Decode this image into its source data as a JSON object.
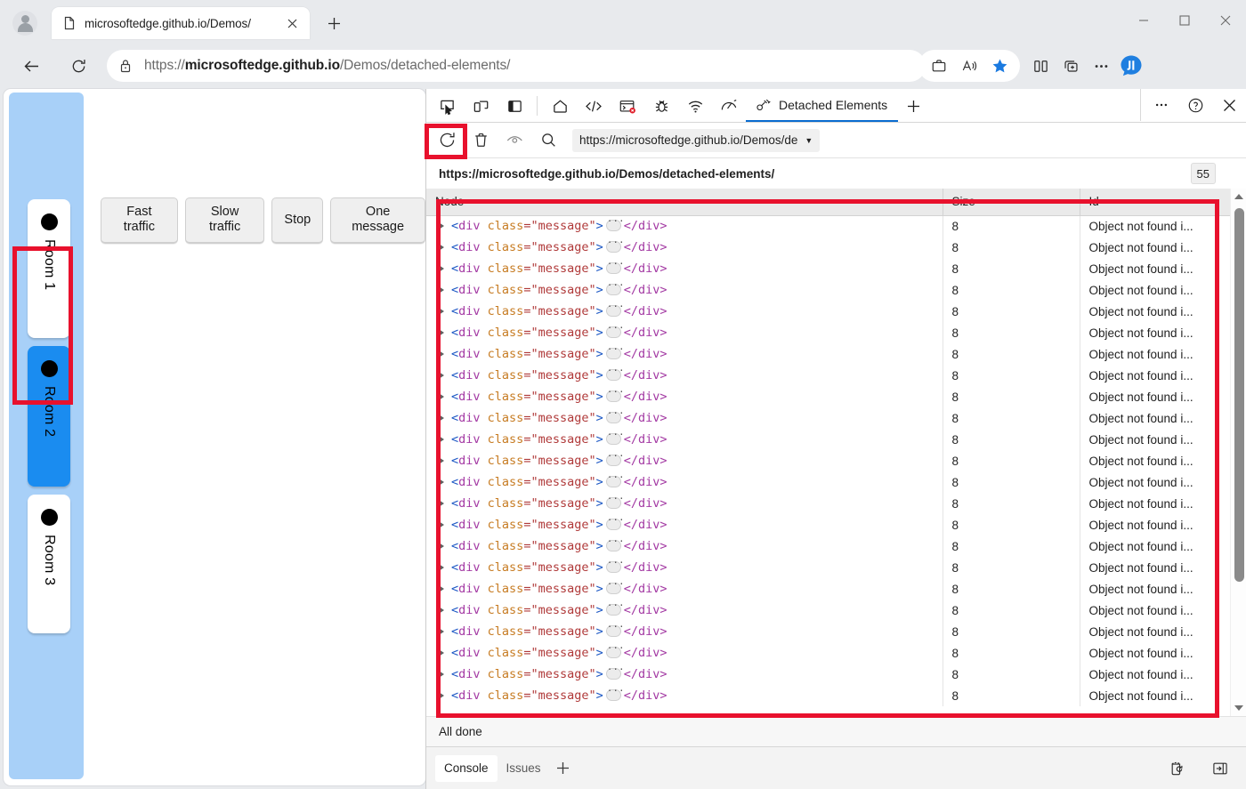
{
  "browser": {
    "tab": {
      "title": "microsoftedge.github.io/Demos/",
      "favicon_icon": "page-icon",
      "close_icon": "close-icon"
    },
    "new_tab_icon": "plus-icon",
    "window_controls": {
      "minimize_icon": "minimize-icon",
      "maximize_icon": "maximize-icon",
      "close_icon": "close-icon"
    },
    "nav": {
      "back_icon": "back-arrow-icon",
      "reload_icon": "reload-icon"
    },
    "omnibox": {
      "lock_icon": "lock-icon",
      "url_scheme": "https://",
      "url_host": "microsoftedge.github.io",
      "url_path": "/Demos/detached-elements/",
      "url_full": "https://microsoftedge.github.io/Demos/detached-elements/"
    },
    "toolbar_right": {
      "collections_icon": "briefcase-icon",
      "read_aloud_icon": "read-aloud-icon",
      "favorite_icon": "star-filled-icon",
      "split_screen_icon": "split-screen-icon",
      "add_tab_group_icon": "add-tab-group-icon",
      "settings_more_icon": "ellipsis-icon",
      "copilot_icon": "copilot-icon"
    }
  },
  "page": {
    "buttons": [
      {
        "label": "Fast traffic"
      },
      {
        "label": "Slow traffic"
      },
      {
        "label": "Stop"
      },
      {
        "label": "One message"
      }
    ],
    "rooms": [
      {
        "label": "Room 1",
        "selected": false
      },
      {
        "label": "Room 2",
        "selected": true
      },
      {
        "label": "Room 3",
        "selected": false
      }
    ]
  },
  "devtools": {
    "tools": [
      {
        "name": "inspect-element",
        "icon": "inspect-cursor-icon"
      },
      {
        "name": "device-emulation",
        "icon": "device-toggle-icon"
      },
      {
        "name": "panel-layout",
        "icon": "panel-layout-icon"
      }
    ],
    "panels": [
      {
        "name": "welcome",
        "icon": "home-icon"
      },
      {
        "name": "elements",
        "icon": "code-brackets-icon"
      },
      {
        "name": "console",
        "icon": "console-error-icon"
      },
      {
        "name": "sources",
        "icon": "bug-icon"
      },
      {
        "name": "network",
        "icon": "wifi-icon"
      },
      {
        "name": "performance",
        "icon": "gauge-icon"
      }
    ],
    "selected_panel": {
      "label": "Detached Elements",
      "icon": "detached-elements-icon"
    },
    "add_panel_icon": "plus-icon",
    "tabbar_right": {
      "more_icon": "ellipsis-icon",
      "help_icon": "help-circle-icon",
      "close_icon": "close-icon"
    },
    "toolbar": {
      "refresh_icon": "refresh-icon",
      "delete_icon": "trash-icon",
      "detach_icon": "eye-detach-icon",
      "search_icon": "search-icon",
      "target_select_value": "https://microsoftedge.github.io/Demos/de",
      "target_select_caret": "chevron-down-icon"
    },
    "detached_panel": {
      "origin": "https://microsoftedge.github.io/Demos/detached-elements/",
      "count_badge": "55",
      "columns": [
        "Node",
        "Size",
        "Id"
      ],
      "row_node": {
        "expander_icon": "expand-triangle-icon",
        "open_bracket": "<",
        "tag": "div",
        "attr_name": "class",
        "attr_eq_value": "=\"message\"",
        "close_bracket": ">",
        "children_chip": "···",
        "close_tag": "</div>"
      },
      "rows": [
        {
          "size": "8",
          "id": "Object not found i..."
        },
        {
          "size": "8",
          "id": "Object not found i..."
        },
        {
          "size": "8",
          "id": "Object not found i..."
        },
        {
          "size": "8",
          "id": "Object not found i..."
        },
        {
          "size": "8",
          "id": "Object not found i..."
        },
        {
          "size": "8",
          "id": "Object not found i..."
        },
        {
          "size": "8",
          "id": "Object not found i..."
        },
        {
          "size": "8",
          "id": "Object not found i..."
        },
        {
          "size": "8",
          "id": "Object not found i..."
        },
        {
          "size": "8",
          "id": "Object not found i..."
        },
        {
          "size": "8",
          "id": "Object not found i..."
        },
        {
          "size": "8",
          "id": "Object not found i..."
        },
        {
          "size": "8",
          "id": "Object not found i..."
        },
        {
          "size": "8",
          "id": "Object not found i..."
        },
        {
          "size": "8",
          "id": "Object not found i..."
        },
        {
          "size": "8",
          "id": "Object not found i..."
        },
        {
          "size": "8",
          "id": "Object not found i..."
        },
        {
          "size": "8",
          "id": "Object not found i..."
        },
        {
          "size": "8",
          "id": "Object not found i..."
        },
        {
          "size": "8",
          "id": "Object not found i..."
        },
        {
          "size": "8",
          "id": "Object not found i..."
        },
        {
          "size": "8",
          "id": "Object not found i..."
        },
        {
          "size": "8",
          "id": "Object not found i..."
        }
      ],
      "status": "All done"
    },
    "drawer": {
      "tabs": [
        {
          "label": "Console",
          "active": true
        },
        {
          "label": "Issues",
          "active": false
        }
      ],
      "add_icon": "plus-icon",
      "right_icons": [
        {
          "name": "devtools-refresh-icon"
        },
        {
          "name": "dock-panel-icon"
        }
      ]
    }
  },
  "annotations": {
    "accent_color": "#e8112d",
    "boxes": [
      {
        "name": "room-2-highlight"
      },
      {
        "name": "refresh-button-highlight"
      },
      {
        "name": "detached-table-highlight"
      }
    ]
  }
}
